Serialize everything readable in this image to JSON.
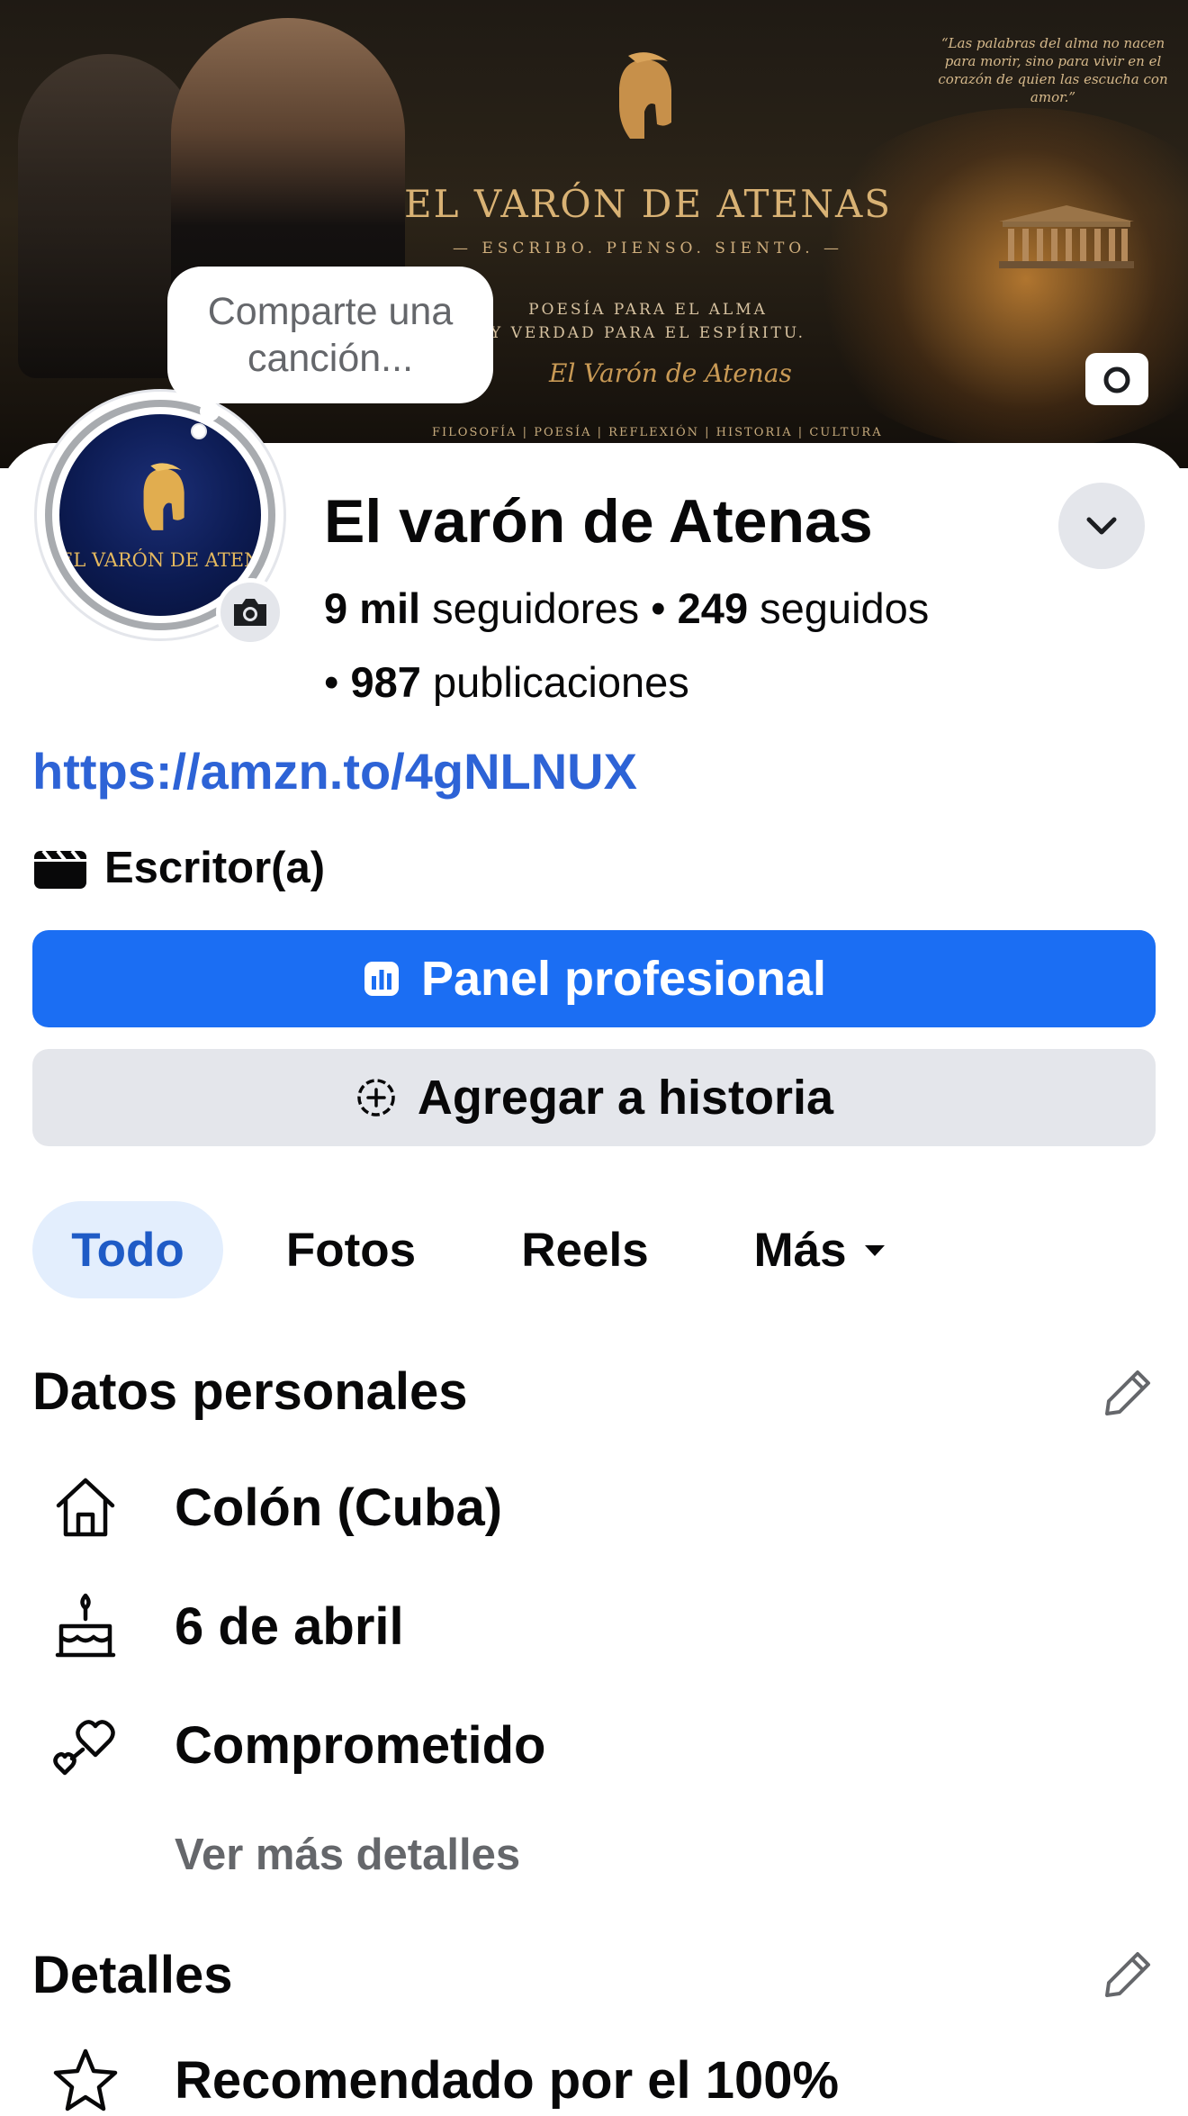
{
  "cover": {
    "title": "EL VARÓN DE ATENAS",
    "subtitle": "— ESCRIBO. PIENSO. SIENTO. —",
    "tagline1": "POESÍA PARA EL ALMA",
    "tagline2": "Y VERDAD PARA EL ESPÍRITU.",
    "signature": "El Varón de Atenas",
    "strip": "FILOSOFÍA | POESÍA | REFLEXIÓN | HISTORIA | CULTURA",
    "quote": "“Las palabras del alma no nacen para morir, sino para vivir en el corazón de quien las escucha con amor.”"
  },
  "note_bubble": "Comparte una canción...",
  "avatar_text": "EL VARÓN DE ATENAS",
  "profile": {
    "name": "El varón de Atenas",
    "followers_count": "9 mil",
    "followers_label": " seguidores • ",
    "following_count": "249",
    "following_label": " seguidos",
    "posts_prefix": "• ",
    "posts_count": "987",
    "posts_label": " publicaciones",
    "link": "https://amzn.to/4gNLNUX",
    "category": "Escritor(a)"
  },
  "buttons": {
    "panel": "Panel profesional",
    "story": "Agregar a historia"
  },
  "tabs": [
    "Todo",
    "Fotos",
    "Reels",
    "Más"
  ],
  "personal": {
    "title": "Datos personales",
    "items": [
      "Colón (Cuba)",
      "6 de abril",
      "Comprometido"
    ],
    "see_more": "Ver más detalles"
  },
  "details": {
    "title": "Detalles",
    "items": [
      "Recomendado por el 100%"
    ]
  },
  "colors": {
    "primary_button": "#1b6ef3",
    "link": "#2d63d6",
    "active_tab_bg": "#e3eefd",
    "active_tab_text": "#1f5bc6",
    "secondary_button": "#e4e6eb",
    "muted_text": "#65676b"
  },
  "icons": [
    "camera-icon",
    "chevron-down-icon",
    "clapperboard-icon",
    "chart-icon",
    "add-story-icon",
    "caret-down-icon",
    "pencil-icon",
    "home-icon",
    "cake-icon",
    "hearts-icon",
    "star-icon"
  ]
}
